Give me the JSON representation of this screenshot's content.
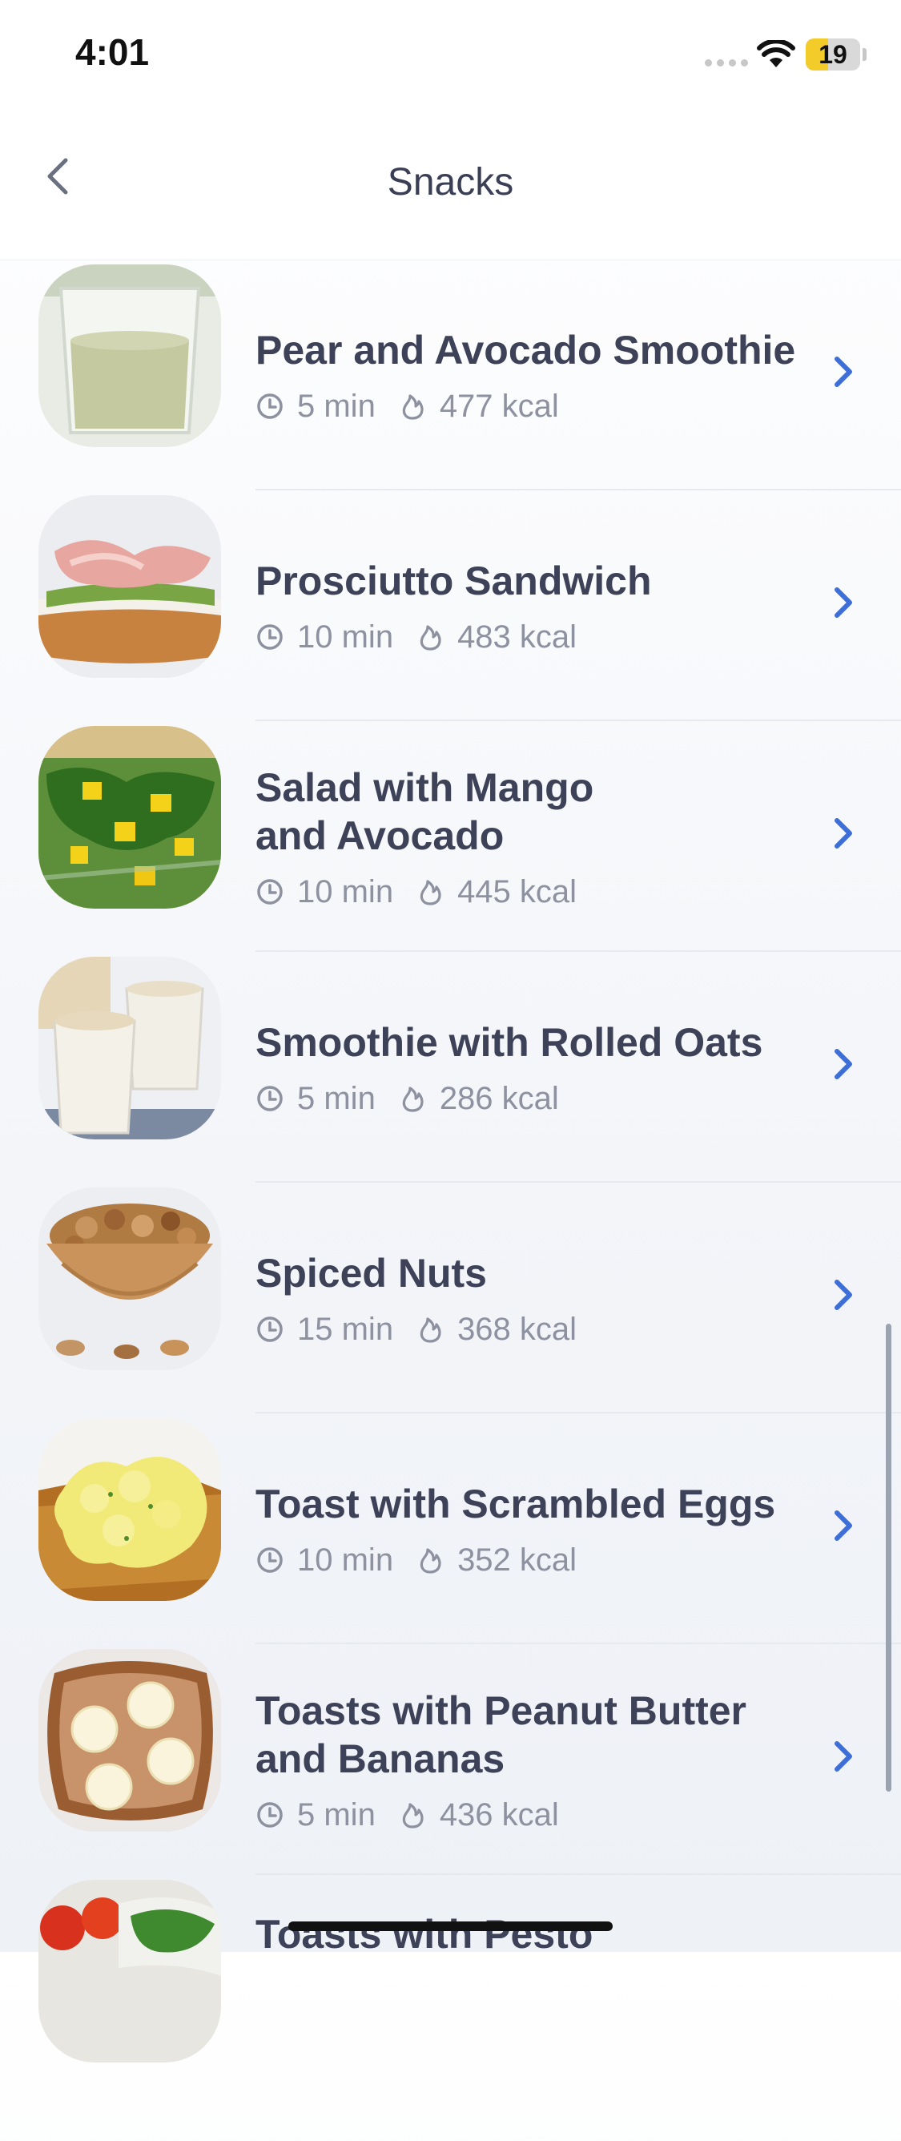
{
  "status_bar": {
    "time": "4:01",
    "battery": "19",
    "battery_level": 0.19
  },
  "nav": {
    "title": "Snacks"
  },
  "recipes": [
    {
      "title": "Pear and Avocado Smoothie",
      "time": "5 min",
      "kcal": "477 kcal",
      "image": "smoothie-glass"
    },
    {
      "title": "Prosciutto Sandwich",
      "time": "10 min",
      "kcal": "483 kcal",
      "image": "prosciutto-toast"
    },
    {
      "title": "Salad with Mango and Avocado",
      "time": "10 min",
      "kcal": "445 kcal",
      "image": "mango-salad"
    },
    {
      "title": "Smoothie with Rolled Oats",
      "time": "5 min",
      "kcal": "286 kcal",
      "image": "oat-smoothie"
    },
    {
      "title": "Spiced Nuts",
      "time": "15 min",
      "kcal": "368 kcal",
      "image": "nuts-bowl"
    },
    {
      "title": "Toast with Scrambled Eggs",
      "time": "10 min",
      "kcal": "352 kcal",
      "image": "egg-toast"
    },
    {
      "title": "Toasts with Peanut Butter and Bananas",
      "time": "5 min",
      "kcal": "436 kcal",
      "image": "peanut-banana-toast"
    },
    {
      "title": "Toasts with Pesto",
      "time": "",
      "kcal": "",
      "image": "pesto-toast"
    }
  ],
  "colors": {
    "accent": "#3e6fd8",
    "title": "#3d4258",
    "meta": "#8d91a0"
  }
}
